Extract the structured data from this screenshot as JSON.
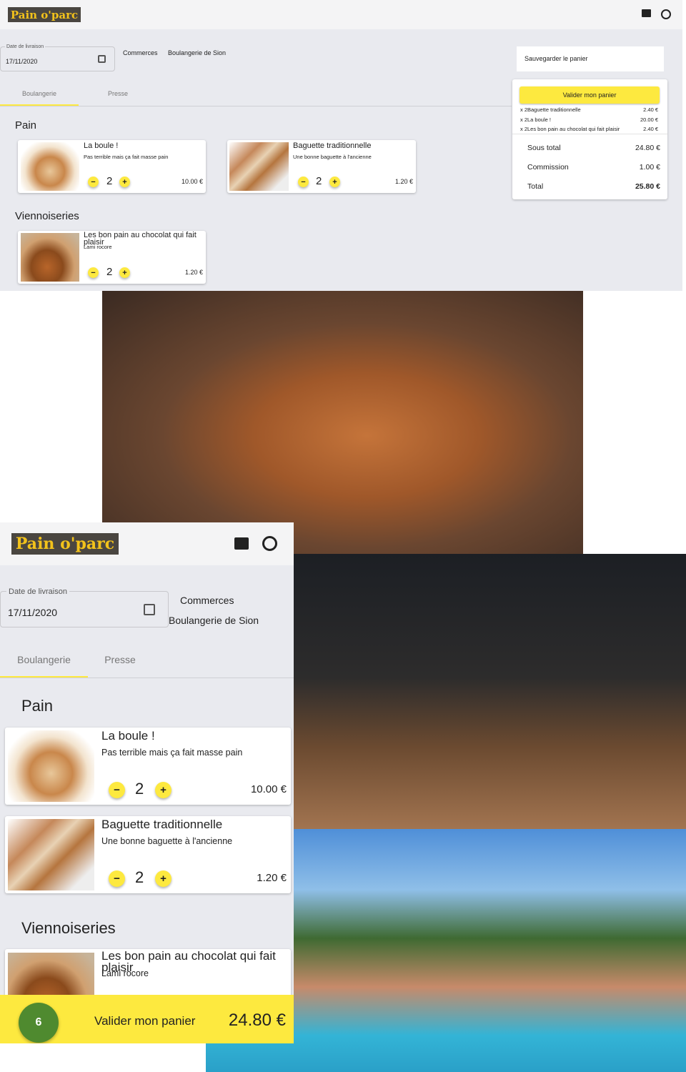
{
  "app": {
    "logo": "Pain o'parc"
  },
  "icons": {
    "chat": "chat-icon",
    "account": "account-face-icon",
    "calendar": "calendar-icon"
  },
  "date_field": {
    "label": "Date de livraison",
    "value": "17/11/2020"
  },
  "breadcrumb": {
    "first": "Commerces",
    "second": "Boulangerie de Sion"
  },
  "tabs": [
    {
      "label": "Boulangerie"
    },
    {
      "label": "Presse"
    }
  ],
  "save_cart": "Sauvegarder le panier",
  "sections": [
    {
      "title": "Pain",
      "products": [
        {
          "name": "La boule !",
          "desc": "Pas terrible mais ça fait masse pain",
          "qty": "2",
          "price": "10.00 €"
        },
        {
          "name": "Baguette traditionnelle",
          "desc": "Une bonne baguette à l'ancienne",
          "qty": "2",
          "price": "1.20 €"
        }
      ]
    },
    {
      "title": "Viennoiseries",
      "products": [
        {
          "name": "Les bon pain au chocolat qui fait plaisir",
          "desc": "Lami rocore",
          "qty": "2",
          "price": "1.20 €"
        }
      ]
    }
  ],
  "cart": {
    "validate": "Valider mon panier",
    "lines": [
      {
        "label": "x 2Baguette traditionnelle",
        "amount": "2.40 €"
      },
      {
        "label": "x 2La boule !",
        "amount": "20.00 €"
      },
      {
        "label": "x 2Les bon pain au chocolat qui fait plaisir",
        "amount": "2.40 €"
      }
    ],
    "subtotal_label": "Sous total",
    "subtotal": "24.80 €",
    "commission_label": "Commission",
    "commission": "1.00 €",
    "total_label": "Total",
    "total": "25.80 €"
  },
  "mobile_bar": {
    "count": "6",
    "label": "Valider mon panier",
    "amount": "24.80 €"
  },
  "colors": {
    "accent": "#fde93f",
    "badge": "#4f8a2f",
    "bg": "#e9eaef"
  }
}
